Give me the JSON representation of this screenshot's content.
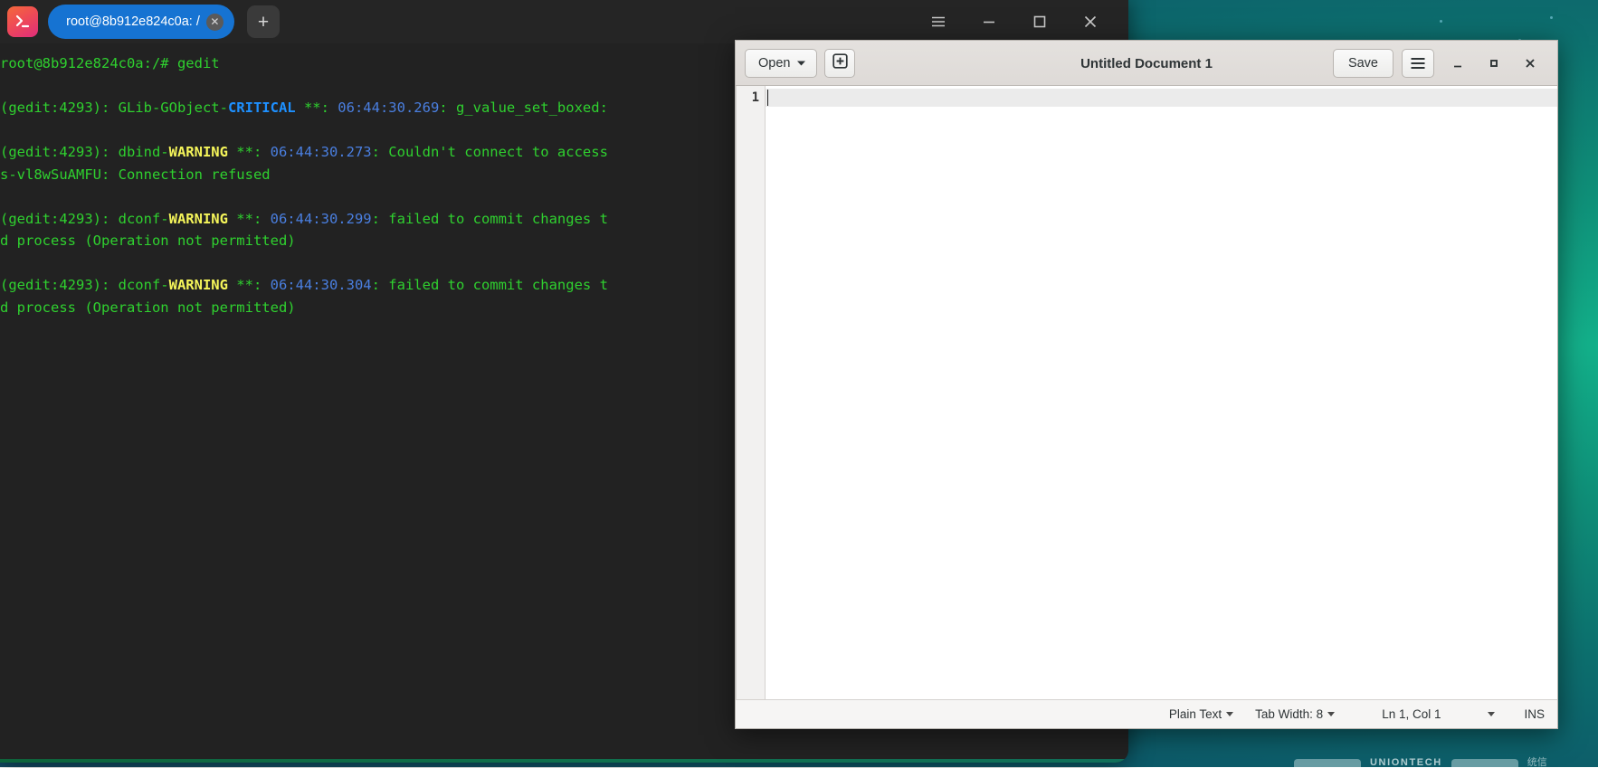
{
  "desktop": {
    "wallpaper_gradient_from": "#0f3f5e",
    "wallpaper_gradient_to": "#14c090",
    "dock": {
      "brand": "UNIONTECH",
      "brand_cn": "统信"
    }
  },
  "terminal": {
    "app_icon": "terminal-prompt-icon",
    "tab": {
      "label": "root@8b912e824c0a: /",
      "close_icon": "close-icon"
    },
    "new_tab_icon": "plus-icon",
    "window_controls": {
      "menu_icon": "hamburger-menu-icon",
      "minimize_icon": "minimize-icon",
      "maximize_icon": "maximize-icon",
      "close_icon": "close-icon"
    },
    "lines": [
      {
        "segments": [
          {
            "text": "root@8b912e824c0a:/# gedit",
            "style": "green"
          }
        ]
      },
      {
        "segments": []
      },
      {
        "segments": [
          {
            "text": "(gedit:4293): GLib-GObject-",
            "style": "green"
          },
          {
            "text": "CRITICAL",
            "style": "cyan"
          },
          {
            "text": " **: ",
            "style": "green"
          },
          {
            "text": "06:44:30.269",
            "style": "blue"
          },
          {
            "text": ": g_value_set_boxed:",
            "style": "green"
          }
        ]
      },
      {
        "segments": []
      },
      {
        "segments": [
          {
            "text": "(gedit:4293): dbind-",
            "style": "green"
          },
          {
            "text": "WARNING",
            "style": "yellow"
          },
          {
            "text": " **: ",
            "style": "green"
          },
          {
            "text": "06:44:30.273",
            "style": "blue"
          },
          {
            "text": ": Couldn't connect to access",
            "style": "green"
          }
        ]
      },
      {
        "segments": [
          {
            "text": "s-vl8wSuAMFU: Connection refused",
            "style": "green"
          }
        ]
      },
      {
        "segments": []
      },
      {
        "segments": [
          {
            "text": "(gedit:4293): dconf-",
            "style": "green"
          },
          {
            "text": "WARNING",
            "style": "yellow"
          },
          {
            "text": " **: ",
            "style": "green"
          },
          {
            "text": "06:44:30.299",
            "style": "blue"
          },
          {
            "text": ": failed to commit changes t",
            "style": "green"
          }
        ]
      },
      {
        "segments": [
          {
            "text": "d process (Operation not permitted)",
            "style": "green"
          }
        ]
      },
      {
        "segments": []
      },
      {
        "segments": [
          {
            "text": "(gedit:4293): dconf-",
            "style": "green"
          },
          {
            "text": "WARNING",
            "style": "yellow"
          },
          {
            "text": " **: ",
            "style": "green"
          },
          {
            "text": "06:44:30.304",
            "style": "blue"
          },
          {
            "text": ": failed to commit changes t",
            "style": "green"
          }
        ]
      },
      {
        "segments": [
          {
            "text": "d process (Operation not permitted)",
            "style": "green"
          }
        ]
      }
    ],
    "colors": {
      "background": "#222222",
      "titlebar": "#252525",
      "tab_active": "#1673d2",
      "text_green": "#2fd12f",
      "text_blue": "#4a7fe0",
      "text_critical": "#1e90ff",
      "text_warning": "#f5f55a"
    }
  },
  "gedit": {
    "title": "Untitled Document 1",
    "open_button_label": "Open",
    "open_button_caret": "chevron-down-icon",
    "new_document_icon": "plus-in-box-icon",
    "save_button_label": "Save",
    "menu_icon": "hamburger-menu-icon",
    "window_controls": {
      "minimize_icon": "minimize-icon",
      "maximize_icon": "maximize-icon",
      "close_icon": "close-icon"
    },
    "editor": {
      "line_numbers": [
        "1"
      ],
      "content": ""
    },
    "statusbar": {
      "language": "Plain Text",
      "tab_width": "Tab Width: 8",
      "cursor_position": "Ln 1, Col 1",
      "position_caret": "chevron-down-icon",
      "insert_mode": "INS"
    },
    "colors": {
      "headerbar": "#e4e1de",
      "chrome": "#f6f5f4",
      "editor_background": "#ffffff",
      "current_line": "#ebebeb"
    }
  }
}
